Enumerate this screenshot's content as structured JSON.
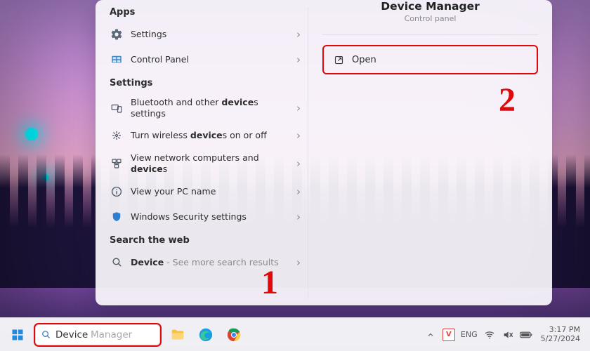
{
  "search_value": "Device",
  "search_placeholder": "Manager",
  "sections": {
    "apps_title": "Apps",
    "settings_title": "Settings",
    "web_title": "Search the web"
  },
  "apps": {
    "settings": "Settings",
    "control_panel": "Control Panel"
  },
  "settings_items": {
    "bt_prefix": "Bluetooth and other ",
    "bt_bold": "device",
    "bt_suffix": "s settings",
    "wifi_prefix": "Turn wireless ",
    "wifi_bold": "device",
    "wifi_suffix": "s on or off",
    "net_prefix": "View network computers and ",
    "net_bold": "device",
    "net_suffix": "s",
    "pc_name": "View your PC name",
    "security": "Windows Security settings"
  },
  "web_item": {
    "bold": "Device",
    "rest": " - See more search results"
  },
  "right_panel": {
    "title": "Device Manager",
    "subtitle": "Control panel",
    "open_label": "Open"
  },
  "tray": {
    "unikey": "V",
    "lang": "ENG",
    "time": "3:17 PM",
    "date": "5/27/2024"
  },
  "annotations": {
    "one": "1",
    "two": "2"
  }
}
